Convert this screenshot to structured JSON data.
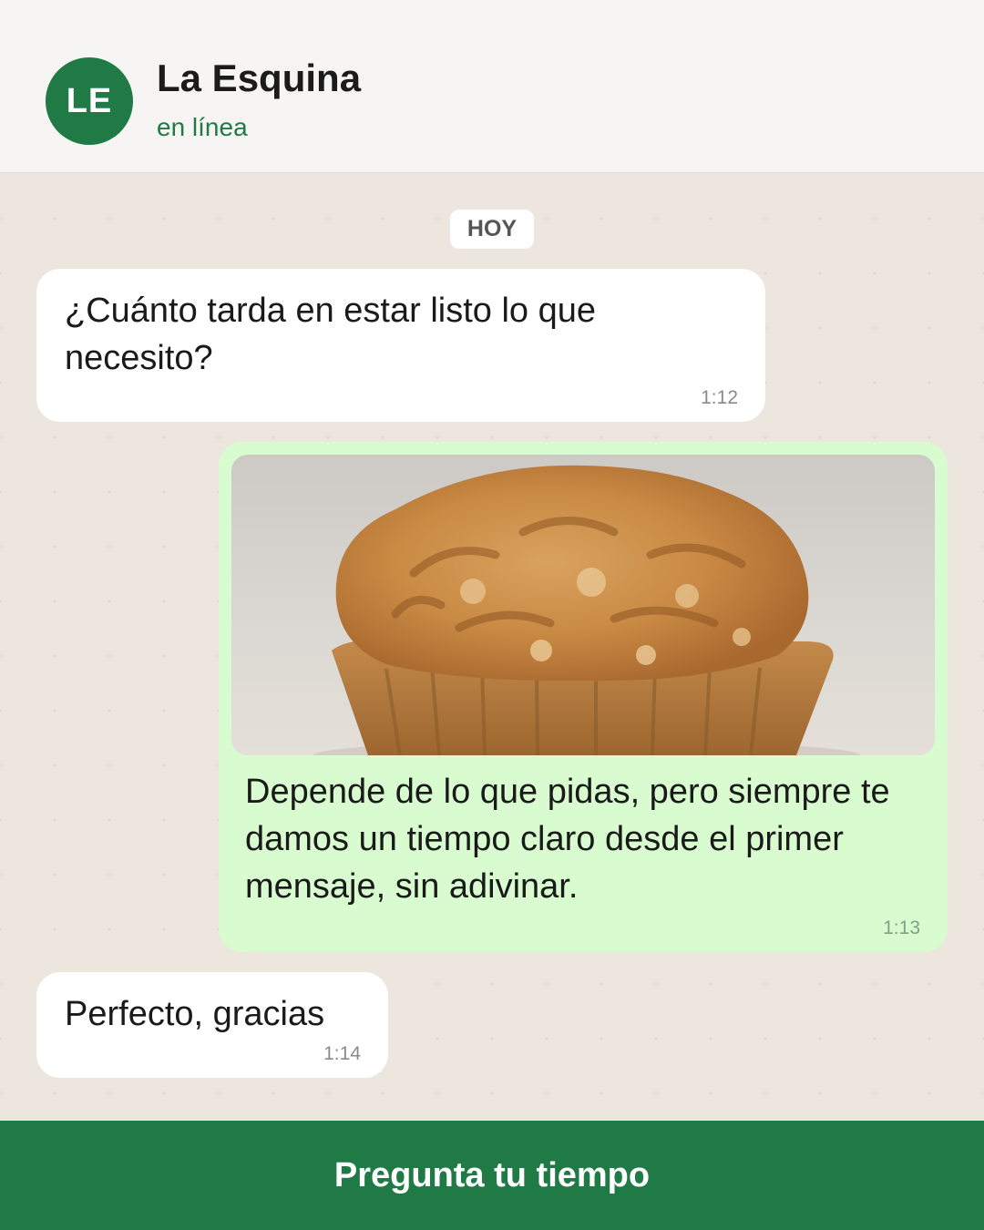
{
  "header": {
    "avatar_initials": "LE",
    "contact_name": "La Esquina",
    "status": "en línea"
  },
  "chat": {
    "date_label": "HOY",
    "messages": [
      {
        "direction": "incoming",
        "text": "¿Cuánto tarda en estar listo lo que necesito?",
        "time": "1:12"
      },
      {
        "direction": "outgoing",
        "image": "muffin-photo",
        "text": "Depende de lo que pidas, pero siempre te damos un tiempo claro desde el primer mensaje, sin adivinar.",
        "time": "1:13"
      },
      {
        "direction": "incoming",
        "text": "Perfecto, gracias",
        "time": "1:14"
      }
    ]
  },
  "cta": {
    "label": "Pregunta tu tiempo"
  },
  "colors": {
    "brand_green": "#1f7a45",
    "chat_background": "#ede6de",
    "outgoing_bubble": "#d9fbd0",
    "incoming_bubble": "#ffffff"
  }
}
